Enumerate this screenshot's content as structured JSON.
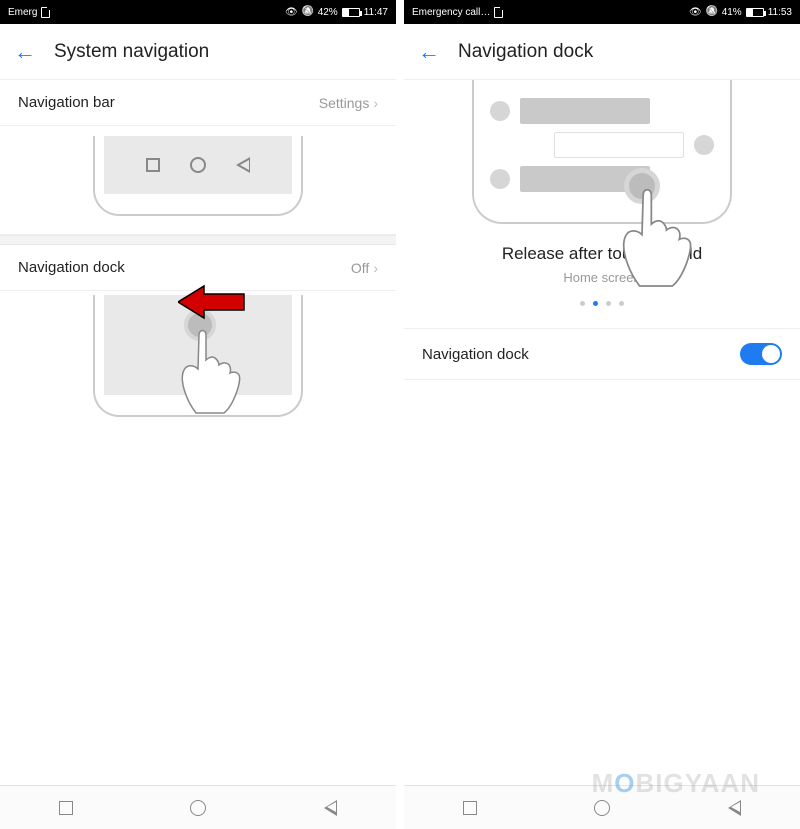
{
  "left": {
    "status": {
      "carrier": "Emerg",
      "battery_pct": "42%",
      "time": "11:47"
    },
    "header": {
      "title": "System navigation"
    },
    "nav_bar_row": {
      "label": "Navigation bar",
      "value": "Settings"
    },
    "nav_dock_row": {
      "label": "Navigation dock",
      "value": "Off"
    }
  },
  "right": {
    "status": {
      "carrier": "Emergency call…",
      "battery_pct": "41%",
      "time": "11:53"
    },
    "header": {
      "title": "Navigation dock"
    },
    "tutorial": {
      "title": "Release after touch & hold",
      "subtitle": "Home screen",
      "active_dot_index": 1,
      "dot_count": 4
    },
    "toggle_row": {
      "label": "Navigation dock",
      "state": "on"
    }
  },
  "watermark": {
    "pre": "M",
    "o": "O",
    "post": "BIGYAAN"
  }
}
